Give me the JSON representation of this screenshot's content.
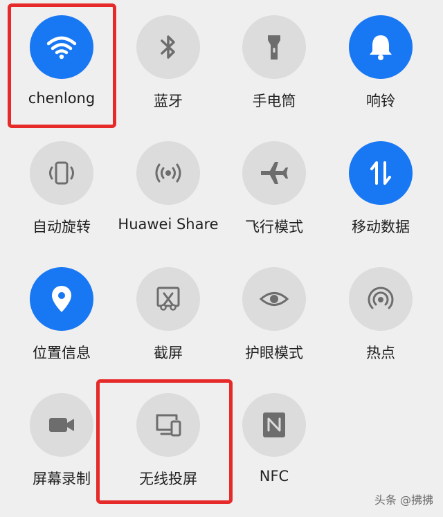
{
  "colors": {
    "active": "#1877f2",
    "inactive": "#dcdcdc",
    "icon_inactive": "#6d6d6d",
    "highlight": "#e62a2a"
  },
  "tiles": [
    {
      "label": "chenlong",
      "icon": "wifi-icon",
      "active": true
    },
    {
      "label": "蓝牙",
      "icon": "bluetooth-icon",
      "active": false
    },
    {
      "label": "手电筒",
      "icon": "flashlight-icon",
      "active": false
    },
    {
      "label": "响铃",
      "icon": "bell-icon",
      "active": true
    },
    {
      "label": "自动旋转",
      "icon": "auto-rotate-icon",
      "active": false
    },
    {
      "label": "Huawei Share",
      "icon": "huawei-share-icon",
      "active": false
    },
    {
      "label": "飞行模式",
      "icon": "airplane-icon",
      "active": false
    },
    {
      "label": "移动数据",
      "icon": "mobile-data-icon",
      "active": true
    },
    {
      "label": "位置信息",
      "icon": "location-icon",
      "active": true
    },
    {
      "label": "截屏",
      "icon": "screenshot-icon",
      "active": false
    },
    {
      "label": "护眼模式",
      "icon": "eye-icon",
      "active": false
    },
    {
      "label": "热点",
      "icon": "hotspot-icon",
      "active": false
    },
    {
      "label": "屏幕录制",
      "icon": "screen-record-icon",
      "active": false
    },
    {
      "label": "无线投屏",
      "icon": "wireless-projection-icon",
      "active": false
    },
    {
      "label": "NFC",
      "icon": "nfc-icon",
      "active": false
    }
  ],
  "watermark": "头条 @拂拂"
}
